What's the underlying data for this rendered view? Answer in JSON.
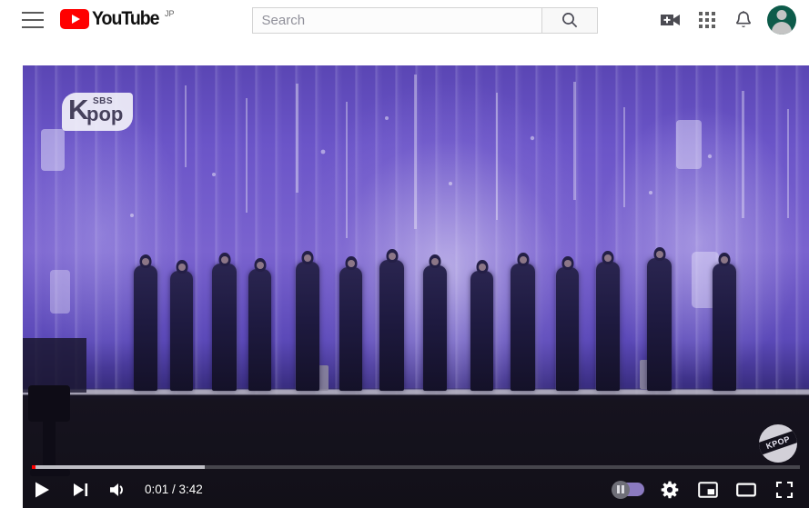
{
  "header": {
    "menu_icon": "hamburger-menu-icon",
    "logo": {
      "wordmark": "YouTube",
      "country_suffix": "JP",
      "play_icon": "youtube-play-icon",
      "brand_color": "#ff0000"
    },
    "search": {
      "value": "",
      "placeholder": "Search",
      "button_icon": "search-icon"
    },
    "actions": [
      {
        "name": "create-video-icon",
        "label": "Create"
      },
      {
        "name": "apps-grid-icon",
        "label": "YouTube apps"
      },
      {
        "name": "notifications-bell-icon",
        "label": "Notifications"
      },
      {
        "name": "avatar",
        "label": "Account"
      }
    ],
    "avatar_color": "#0d5b4a"
  },
  "player": {
    "state": "paused",
    "watermark_brand": {
      "k": "K",
      "sbs": "SBS",
      "pop": "pop"
    },
    "corner_badge": "KPOP",
    "progress": {
      "played_percent": 0.45,
      "loaded_percent": 22.5,
      "played_color": "#ff0000",
      "loaded_color": "#e2e2e8"
    },
    "time": {
      "current": "0:01",
      "separator": "/",
      "duration": "3:42",
      "display": "0:01 / 3:42"
    },
    "controls": [
      {
        "name": "play-button",
        "label": "Play",
        "icon": "play-icon"
      },
      {
        "name": "next-video-button",
        "label": "Next",
        "icon": "next-track-icon"
      },
      {
        "name": "volume-button",
        "label": "Mute",
        "icon": "volume-on-icon"
      }
    ],
    "right_controls": [
      {
        "name": "autoplay-toggle",
        "label": "Autoplay",
        "icon": "autoplay-pause-toggle",
        "state": "paused",
        "accent": "#8b7ac0"
      },
      {
        "name": "settings-button",
        "label": "Settings",
        "icon": "gear-icon"
      },
      {
        "name": "miniplayer-button",
        "label": "Miniplayer",
        "icon": "miniplayer-icon"
      },
      {
        "name": "theater-button",
        "label": "Theater mode",
        "icon": "theater-mode-icon"
      },
      {
        "name": "fullscreen-button",
        "label": "Full screen",
        "icon": "fullscreen-icon"
      }
    ]
  }
}
